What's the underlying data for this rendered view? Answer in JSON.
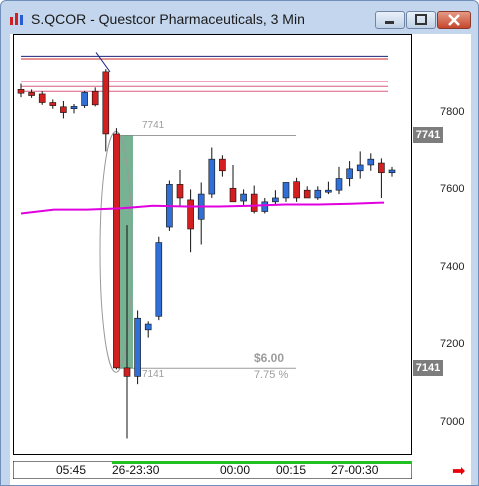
{
  "window": {
    "title": "S.QCOR - Questcor Pharmaceuticals, 3 Min",
    "controls": [
      "minimize",
      "maximize",
      "close"
    ]
  },
  "price_axis": {
    "labels": [
      "7800",
      "7600",
      "7400",
      "7200",
      "7000"
    ],
    "tags": {
      "upper": "7741",
      "lower": "7141"
    }
  },
  "time_axis": {
    "labels": [
      "05:45",
      "26-23:30",
      "00:00",
      "00:15",
      "27-00:30"
    ]
  },
  "annotations": {
    "upper_level": "7741",
    "lower_level": "7141",
    "range_value": "$6.00",
    "range_percent": "7.75 %"
  },
  "colors": {
    "up_candle": "#2f6fd6",
    "down_candle": "#d22020",
    "moving_average": "#e000e0",
    "highlight": "#2e8b57",
    "timeline_green": "#22c022",
    "nav_arrow": "#e8000b"
  },
  "chart_data": {
    "type": "candlestick",
    "ylim": [
      6920,
      8000
    ],
    "price_unit": "cents",
    "candles": [
      {
        "o": 7860,
        "h": 7875,
        "l": 7840,
        "c": 7850
      },
      {
        "o": 7852,
        "h": 7860,
        "l": 7838,
        "c": 7844
      },
      {
        "o": 7848,
        "h": 7855,
        "l": 7820,
        "c": 7826
      },
      {
        "o": 7826,
        "h": 7834,
        "l": 7810,
        "c": 7818
      },
      {
        "o": 7815,
        "h": 7830,
        "l": 7785,
        "c": 7800
      },
      {
        "o": 7810,
        "h": 7822,
        "l": 7798,
        "c": 7816
      },
      {
        "o": 7818,
        "h": 7856,
        "l": 7812,
        "c": 7852
      },
      {
        "o": 7855,
        "h": 7865,
        "l": 7816,
        "c": 7820
      },
      {
        "o": 7905,
        "h": 7912,
        "l": 7700,
        "c": 7745
      },
      {
        "o": 7745,
        "h": 7760,
        "l": 7138,
        "c": 7142
      },
      {
        "o": 7142,
        "h": 7510,
        "l": 6960,
        "c": 7120
      },
      {
        "o": 7120,
        "h": 7290,
        "l": 7100,
        "c": 7270
      },
      {
        "o": 7240,
        "h": 7262,
        "l": 7220,
        "c": 7255
      },
      {
        "o": 7275,
        "h": 7480,
        "l": 7265,
        "c": 7465
      },
      {
        "o": 7505,
        "h": 7625,
        "l": 7495,
        "c": 7615
      },
      {
        "o": 7615,
        "h": 7652,
        "l": 7560,
        "c": 7580
      },
      {
        "o": 7575,
        "h": 7602,
        "l": 7440,
        "c": 7500
      },
      {
        "o": 7525,
        "h": 7620,
        "l": 7460,
        "c": 7590
      },
      {
        "o": 7590,
        "h": 7710,
        "l": 7580,
        "c": 7680
      },
      {
        "o": 7680,
        "h": 7690,
        "l": 7635,
        "c": 7650
      },
      {
        "o": 7605,
        "h": 7665,
        "l": 7570,
        "c": 7570
      },
      {
        "o": 7572,
        "h": 7602,
        "l": 7562,
        "c": 7590
      },
      {
        "o": 7590,
        "h": 7612,
        "l": 7540,
        "c": 7545
      },
      {
        "o": 7545,
        "h": 7580,
        "l": 7540,
        "c": 7570
      },
      {
        "o": 7570,
        "h": 7600,
        "l": 7562,
        "c": 7580
      },
      {
        "o": 7580,
        "h": 7620,
        "l": 7570,
        "c": 7620
      },
      {
        "o": 7622,
        "h": 7632,
        "l": 7570,
        "c": 7580
      },
      {
        "o": 7600,
        "h": 7610,
        "l": 7580,
        "c": 7580
      },
      {
        "o": 7580,
        "h": 7610,
        "l": 7575,
        "c": 7600
      },
      {
        "o": 7600,
        "h": 7622,
        "l": 7590,
        "c": 7600
      },
      {
        "o": 7600,
        "h": 7660,
        "l": 7590,
        "c": 7630
      },
      {
        "o": 7630,
        "h": 7675,
        "l": 7610,
        "c": 7655
      },
      {
        "o": 7650,
        "h": 7700,
        "l": 7630,
        "c": 7665
      },
      {
        "o": 7665,
        "h": 7695,
        "l": 7650,
        "c": 7680
      },
      {
        "o": 7670,
        "h": 7682,
        "l": 7580,
        "c": 7645
      },
      {
        "o": 7645,
        "h": 7660,
        "l": 7635,
        "c": 7652
      }
    ],
    "moving_average": [
      7540,
      7550,
      7550,
      7553,
      7560,
      7558,
      7558,
      7560,
      7563,
      7563,
      7565,
      7568
    ],
    "horizontal_lines": [
      {
        "y": 7945,
        "color": "#1a237e"
      },
      {
        "y": 7938,
        "color": "#cc2b2b"
      },
      {
        "y": 7880,
        "color": "#f0a0c0"
      },
      {
        "y": 7868,
        "color": "#d75f80"
      },
      {
        "y": 7855,
        "color": "#d75f80"
      },
      {
        "y": 7741,
        "color": "#9c9c9c"
      },
      {
        "y": 7141,
        "color": "#9c9c9c"
      }
    ]
  }
}
